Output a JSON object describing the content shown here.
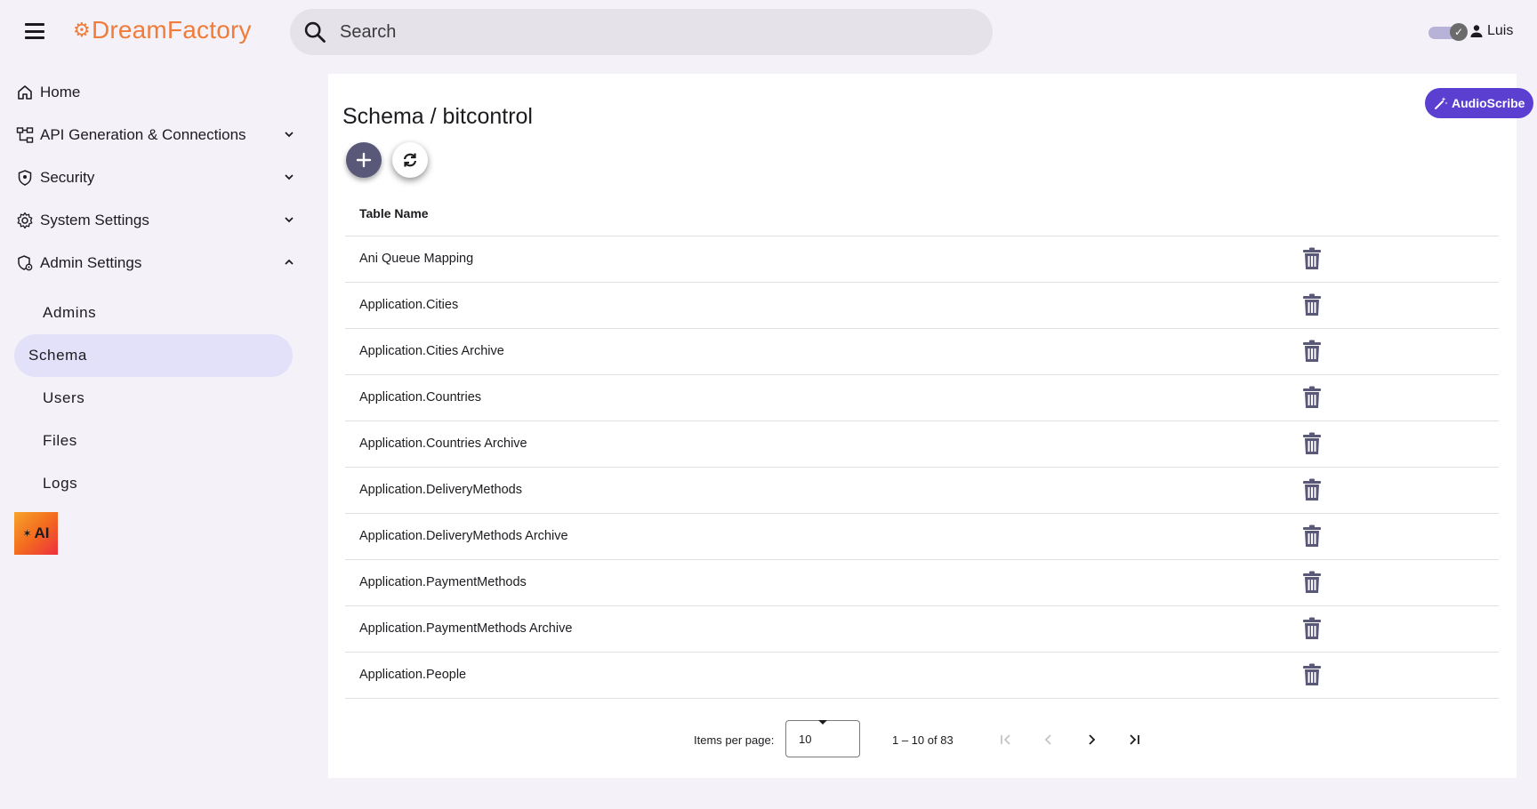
{
  "header": {
    "logo": "DreamFactory",
    "search_placeholder": "Search",
    "user_name": "Luis"
  },
  "sidebar": {
    "items": [
      {
        "label": "Home",
        "icon": "home-icon"
      },
      {
        "label": "API Generation & Connections",
        "icon": "api-connections-icon",
        "expanded": false
      },
      {
        "label": "Security",
        "icon": "shield-icon",
        "expanded": false
      },
      {
        "label": "System Settings",
        "icon": "gear-icon",
        "expanded": false
      },
      {
        "label": "Admin Settings",
        "icon": "admin-shield-icon",
        "expanded": true
      }
    ],
    "admin_subitems": [
      "Admins",
      "Schema",
      "Users",
      "Files",
      "Logs"
    ],
    "active_subitem": "Schema",
    "ai_label": "AI"
  },
  "main": {
    "title": "Schema / bitcontrol",
    "audioscribe_label": "AudioScribe",
    "table": {
      "column_header": "Table Name",
      "rows": [
        "Ani Queue Mapping",
        "Application.Cities",
        "Application.Cities Archive",
        "Application.Countries",
        "Application.Countries Archive",
        "Application.DeliveryMethods",
        "Application.DeliveryMethods Archive",
        "Application.PaymentMethods",
        "Application.PaymentMethods Archive",
        "Application.People"
      ]
    },
    "paginator": {
      "items_per_page_label": "Items per page:",
      "items_per_page_value": "10",
      "range_label": "1 – 10 of 83"
    }
  },
  "colors": {
    "accent": "#5b3fd0",
    "logo": "#f07c3c",
    "active_nav_bg": "#e3e0fa",
    "trash": "#5a5878"
  }
}
